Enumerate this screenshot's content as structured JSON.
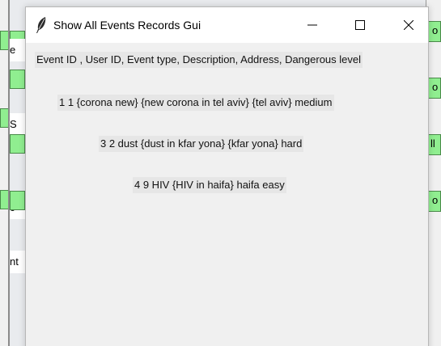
{
  "window": {
    "title": "Show All Events Records Gui",
    "icon": "feather-icon",
    "controls": {
      "minimize_icon": "minimize-icon",
      "maximize_icon": "maximize-icon",
      "close_icon": "close-icon"
    }
  },
  "records": {
    "header": "Event ID , User ID, Event type, Description, Address, Dangerous level",
    "rows": [
      "1 1 {corona new} {new corona in tel aviv} {tel aviv} medium",
      "3 2 dust {dust in kfar yona} {kfar yona} hard",
      "4 9 HIV {HIV in haifa} haifa easy"
    ]
  },
  "background_window": {
    "left_fragments": [
      "e",
      "S",
      "c",
      "nt"
    ],
    "right_fragments": [
      "o",
      "o",
      "ll",
      "o"
    ],
    "button_color": "#90ee90"
  },
  "colors": {
    "window_bg": "#f0f0f0",
    "titlebar_bg": "#ffffff",
    "label_bg": "#e6e6e6"
  }
}
